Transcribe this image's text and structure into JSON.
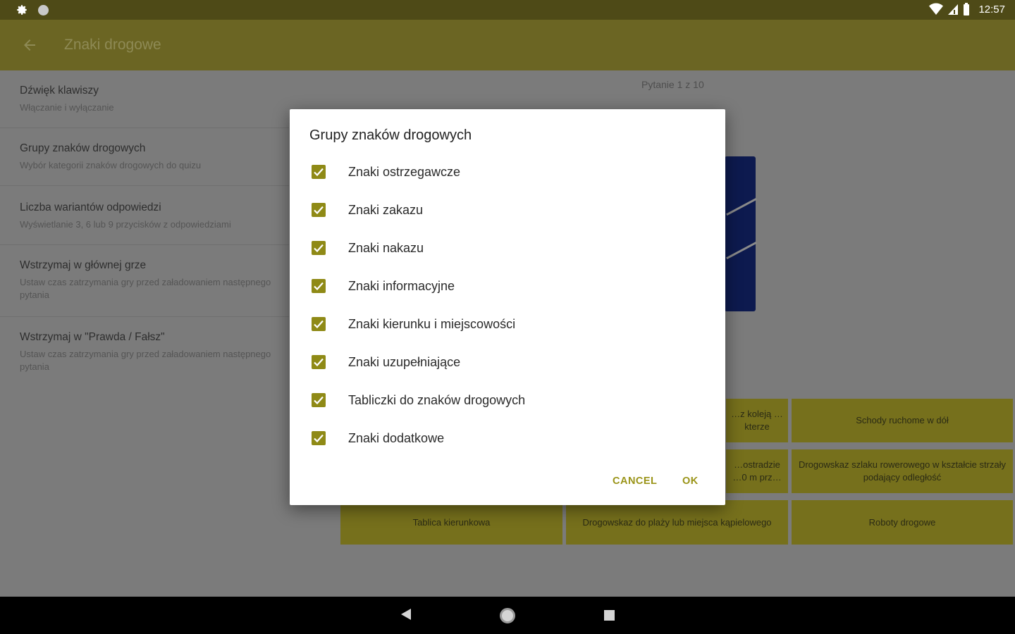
{
  "status_bar": {
    "time": "12:57"
  },
  "app_bar": {
    "title": "Znaki drogowe"
  },
  "settings": [
    {
      "title": "Dźwięk klawiszy",
      "subtitle": "Włączanie i wyłączanie"
    },
    {
      "title": "Grupy znaków drogowych",
      "subtitle": "Wybór kategorii znaków drogowych do quizu"
    },
    {
      "title": "Liczba wariantów odpowiedzi",
      "subtitle": "Wyświetlanie 3, 6 lub 9 przycisków z odpowiedziami"
    },
    {
      "title": "Wstrzymaj w głównej grze",
      "subtitle": "Ustaw czas zatrzymania gry przed załadowaniem następnego pytania"
    },
    {
      "title": "Wstrzymaj w \"Prawda / Fałsz\"",
      "subtitle": "Ustaw czas zatrzymania gry przed załadowaniem następnego pytania"
    }
  ],
  "quiz": {
    "counter": "Pytanie 1 z 10",
    "answers": [
      "…z koleją …kterze",
      "Schody ruchome w dół",
      "…ostradzie …0 m prz…",
      "Drogowskaz szlaku rowerowego w kształcie strzały podający odległość",
      "Tablica kierunkowa",
      "Drogowskaz do plaży lub miejsca kąpielowego",
      "Roboty drogowe"
    ]
  },
  "dialog": {
    "title": "Grupy znaków drogowych",
    "options": [
      {
        "label": "Znaki ostrzegawcze",
        "checked": true
      },
      {
        "label": "Znaki zakazu",
        "checked": true
      },
      {
        "label": "Znaki nakazu",
        "checked": true
      },
      {
        "label": "Znaki informacyjne",
        "checked": true
      },
      {
        "label": "Znaki kierunku i miejscowości",
        "checked": true
      },
      {
        "label": "Znaki uzupełniające",
        "checked": true
      },
      {
        "label": "Tabliczki do znaków drogowych",
        "checked": true
      },
      {
        "label": "Znaki dodatkowe",
        "checked": true
      }
    ],
    "cancel_label": "CANCEL",
    "ok_label": "OK"
  },
  "colors": {
    "accent": "#8f8a16",
    "app_bar": "#6b6523",
    "status_bar": "#4e4a17",
    "answer_button": "#76701c"
  },
  "icons": {
    "status_left": [
      "gear-icon",
      "circle-notification-icon"
    ],
    "status_right": [
      "wifi-icon",
      "signal-icon",
      "battery-icon"
    ],
    "nav": [
      "back-triangle-icon",
      "home-circle-icon",
      "recents-square-icon"
    ]
  }
}
